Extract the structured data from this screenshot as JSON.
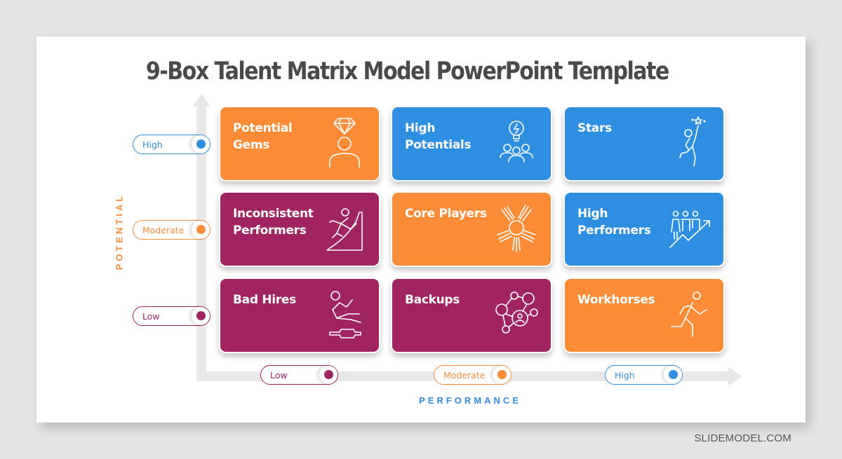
{
  "title": "9-Box Talent Matrix Model PowerPoint Template",
  "colors": {
    "orange": "#fa8c38",
    "blue": "#2e8fe0",
    "purple": "#a02362",
    "axis": "#e8e8e8",
    "title": "#4a4a4a"
  },
  "axes": {
    "y_label": "POTENTIAL",
    "x_label": "PERFORMANCE",
    "y_levels": [
      {
        "label": "High",
        "color": "blue"
      },
      {
        "label": "Moderate",
        "color": "orange"
      },
      {
        "label": "Low",
        "color": "purple"
      }
    ],
    "x_levels": [
      {
        "label": "Low",
        "color": "purple"
      },
      {
        "label": "Moderate",
        "color": "orange"
      },
      {
        "label": "High",
        "color": "blue"
      }
    ]
  },
  "cells": [
    {
      "label": "Potential Gems",
      "color": "orange",
      "icon": "diamond-person-icon",
      "potential": "High",
      "performance": "Low"
    },
    {
      "label": "High Potentials",
      "color": "blue",
      "icon": "lightbulb-team-icon",
      "potential": "High",
      "performance": "Moderate"
    },
    {
      "label": "Stars",
      "color": "blue",
      "icon": "reaching-star-icon",
      "potential": "High",
      "performance": "High"
    },
    {
      "label": "Inconsistent Performers",
      "color": "purple",
      "icon": "climbing-person-icon",
      "potential": "Moderate",
      "performance": "Low"
    },
    {
      "label": "Core Players",
      "color": "orange",
      "icon": "hands-together-icon",
      "potential": "Moderate",
      "performance": "Moderate"
    },
    {
      "label": "High Performers",
      "color": "blue",
      "icon": "team-growth-arrow-icon",
      "potential": "Moderate",
      "performance": "High"
    },
    {
      "label": "Bad Hires",
      "color": "purple",
      "icon": "slipping-person-icon",
      "potential": "Low",
      "performance": "Low"
    },
    {
      "label": "Backups",
      "color": "purple",
      "icon": "network-people-icon",
      "potential": "Low",
      "performance": "Moderate"
    },
    {
      "label": "Workhorses",
      "color": "orange",
      "icon": "running-person-icon",
      "potential": "Low",
      "performance": "High"
    }
  ],
  "watermark": "SLIDEMODEL.COM"
}
